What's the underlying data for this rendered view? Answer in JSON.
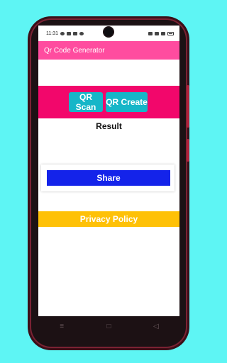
{
  "status_bar": {
    "time": "11:31"
  },
  "app_bar": {
    "title": "Qr Code Generator"
  },
  "buttons": {
    "scan_label": "QR Scan",
    "create_label": "QR Create",
    "share_label": "Share",
    "privacy_label": "Privacy Policy"
  },
  "result_label": "Result",
  "colors": {
    "background": "#5ef5f4",
    "app_bar": "#ff4c9f",
    "pink_band": "#f2076b",
    "action_buttons": "#16b6c8",
    "share_button": "#1423ea",
    "privacy_button": "#fec107"
  },
  "nav": {
    "menu_icon": "menu-icon",
    "home_icon": "home-icon",
    "back_icon": "back-icon"
  }
}
